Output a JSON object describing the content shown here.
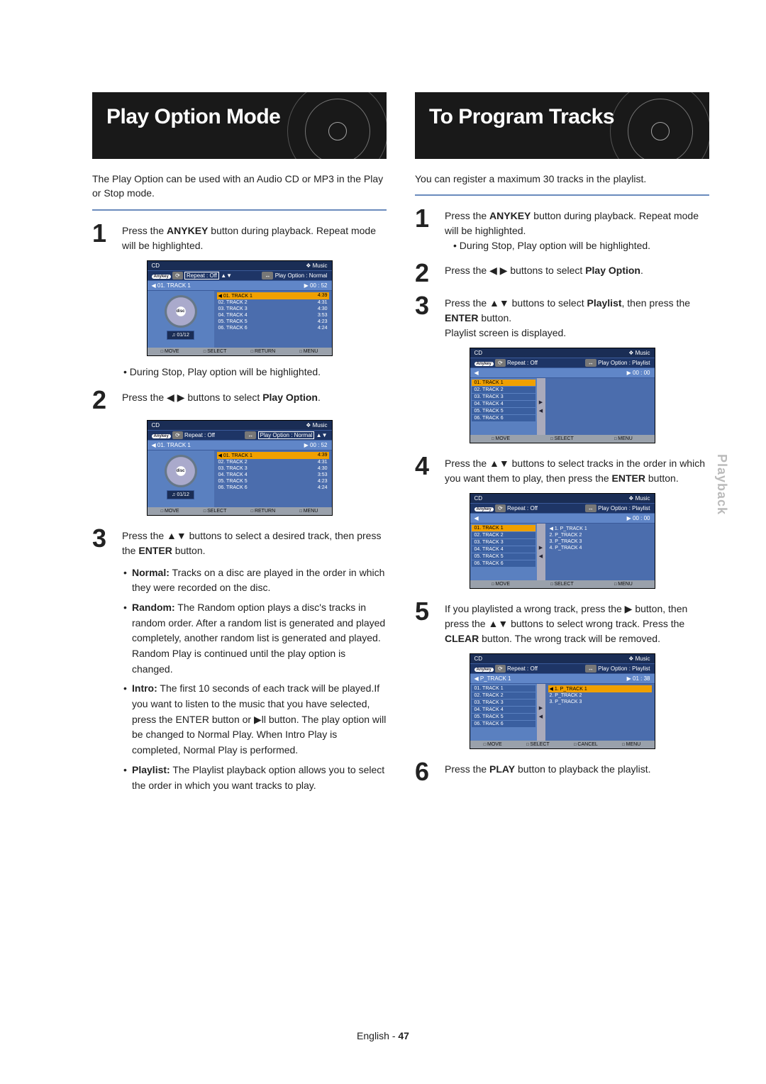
{
  "sideTab": "Playback",
  "footer": {
    "lang": "English -",
    "page": "47"
  },
  "left": {
    "title": "Play Option Mode",
    "intro": "The Play Option can be used with an Audio CD or MP3 in the Play or Stop mode.",
    "step1": {
      "a": "Press the ",
      "b": "ANYKEY",
      "c": " button during playback. Repeat mode will be highlighted."
    },
    "note1": "During Stop, Play option will be highlighted.",
    "step2": {
      "a": "Press the ◀ ▶ buttons to select ",
      "b": "Play Option",
      "c": "."
    },
    "step3": {
      "a": "Press the ▲▼ buttons to select a desired track, then press the ",
      "b": "ENTER",
      "c": " button."
    },
    "bullets": [
      {
        "lead": "Normal:",
        "rest": " Tracks on a disc are played in the order in which they were recorded on the disc."
      },
      {
        "lead": "Random:",
        "rest": " The Random option plays a disc's tracks in random order. After a random list is generated and played completely, another random list is generated and played. Random Play is continued until the play option is changed."
      },
      {
        "lead": "Intro:",
        "rest": " The first 10 seconds of each track will be played.If you want to listen to the music that you have selected, press the ENTER button or ▶ll button. The play option will be changed to Normal Play. When Intro Play is completed, Normal Play is performed."
      },
      {
        "lead": "Playlist:",
        "rest": " The Playlist playback option allows you to select the order in which you want tracks to play."
      }
    ]
  },
  "right": {
    "title": "To Program Tracks",
    "intro": "You can register a maximum 30 tracks in the playlist.",
    "step1": {
      "a": "Press the ",
      "b": "ANYKEY",
      "c": " button during playback. Repeat mode will be highlighted.",
      "sub": "During Stop, Play option will be highlighted."
    },
    "step2": {
      "a": "Press the ◀ ▶ buttons to select ",
      "b": "Play Option",
      "c": "."
    },
    "step3": {
      "a": "Press the ▲▼ buttons to select ",
      "b": "Playlist",
      "c": ", then press the ",
      "d": "ENTER",
      "e": " button.",
      "f": "Playlist screen is displayed."
    },
    "step4": {
      "a": "Press the ▲▼ buttons to select tracks in the order in which you want them to play, then press the ",
      "b": "ENTER",
      "c": " button."
    },
    "step5": {
      "a": "If you playlisted a wrong track, press the ▶ button, then press the ▲▼ buttons to select wrong track. Press the ",
      "b": "CLEAR",
      "c": " button. The wrong track will be removed."
    },
    "step6": {
      "a": "Press the ",
      "b": "PLAY",
      "c": " button to playback the playlist."
    }
  },
  "osd": {
    "cd": "CD",
    "music": "❖  Music",
    "anykey": "Anykey",
    "repeatOff": "Repeat : Off",
    "playOptNormal": "Play Option : Normal",
    "playOptPlaylist": "Play Option : Playlist",
    "nowTrack1": "01. TRACK 1",
    "nowPTrack1": "P_TRACK 1",
    "time": "00 : 52",
    "time0": "00 : 00",
    "time1": "01 : 38",
    "count": "01/12",
    "tracks": [
      {
        "name": "01. TRACK 1",
        "dur": "4:39"
      },
      {
        "name": "02. TRACK 2",
        "dur": "4:31"
      },
      {
        "name": "03. TRACK 3",
        "dur": "4:30"
      },
      {
        "name": "04. TRACK 4",
        "dur": "3:53"
      },
      {
        "name": "05. TRACK 5",
        "dur": "4:23"
      },
      {
        "name": "06. TRACK 6",
        "dur": "4:24"
      }
    ],
    "trackNames": [
      "01. TRACK 1",
      "02. TRACK 2",
      "03. TRACK 3",
      "04. TRACK 4",
      "05. TRACK 5",
      "06. TRACK 6"
    ],
    "pTracks4": [
      "1. P_TRACK 1",
      "2. P_TRACK 2",
      "3. P_TRACK 3",
      "4. P_TRACK 4"
    ],
    "pTracks3": [
      "1. P_TRACK 1",
      "2. P_TRACK 2",
      "3. P_TRACK 3"
    ],
    "foot": {
      "move": "MOVE",
      "select": "SELECT",
      "ret": "RETURN",
      "menu": "MENU",
      "cancel": "CANCEL"
    },
    "discLabel": "disc"
  }
}
